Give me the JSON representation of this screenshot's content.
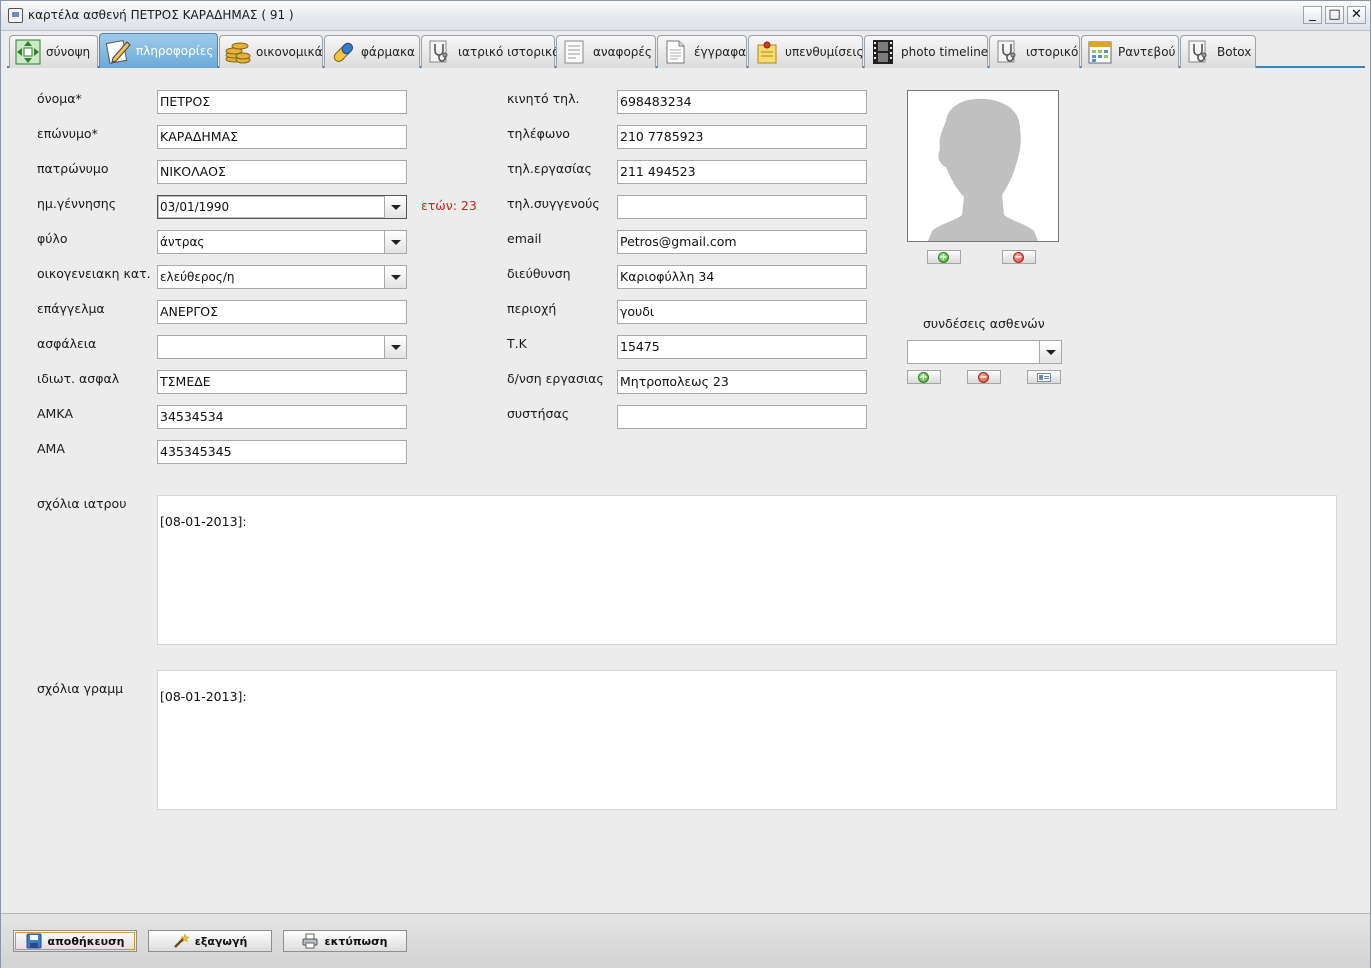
{
  "window": {
    "title": "καρτέλα ασθενή ΠΕΤΡΟΣ ΚΑΡΑΔΗΜΑΣ ( 91 )"
  },
  "window_controls": {
    "minimize": "_",
    "maximize": "□",
    "close": "✕"
  },
  "tabs": [
    {
      "label": "σύνοψη",
      "icon": "overview-arrows-icon",
      "active": false
    },
    {
      "label": "πληροφορίες",
      "icon": "edit-pencil-icon",
      "active": true
    },
    {
      "label": "οικονομικά",
      "icon": "coins-icon",
      "active": false
    },
    {
      "label": "φάρμακα",
      "icon": "pill-icon",
      "active": false
    },
    {
      "label": "ιατρικό ιστορικό",
      "icon": "stethoscope-icon",
      "active": false
    },
    {
      "label": "αναφορές",
      "icon": "report-sheet-icon",
      "active": false
    },
    {
      "label": "έγγραφα",
      "icon": "document-icon",
      "active": false
    },
    {
      "label": "υπενθυμίσεις",
      "icon": "sticky-note-icon",
      "active": false
    },
    {
      "label": "photo timeline",
      "icon": "film-strip-icon",
      "active": false
    },
    {
      "label": "ιστορικό",
      "icon": "stethoscope-icon",
      "active": false
    },
    {
      "label": "Ραντεβού",
      "icon": "calendar-icon",
      "active": false
    },
    {
      "label": "Botox",
      "icon": "stethoscope-icon",
      "active": false
    }
  ],
  "left_form": [
    {
      "label": "όνομα*",
      "value": "ΠΕΤΡΟΣ",
      "type": "text"
    },
    {
      "label": "επώνυμο*",
      "value": "ΚΑΡΑΔΗΜΑΣ",
      "type": "text"
    },
    {
      "label": "πατρώνυμο",
      "value": "ΝΙΚΟΛΑΟΣ",
      "type": "text"
    },
    {
      "label": "ημ.γέννησης",
      "value": "03/01/1990",
      "type": "combo"
    },
    {
      "label": "φύλο",
      "value": "άντρας",
      "type": "combo"
    },
    {
      "label": "οικογενειακη κατ.",
      "value": "ελεύθερος/η",
      "type": "combo"
    },
    {
      "label": "επάγγελμα",
      "value": "ΑΝΕΡΓΟΣ",
      "type": "text"
    },
    {
      "label": "ασφάλεια",
      "value": "",
      "type": "combo"
    },
    {
      "label": "ιδιωτ. ασφαλ",
      "value": "ΤΣΜΕΔΕ",
      "type": "text"
    },
    {
      "label": "ΑΜΚΑ",
      "value": "34534534",
      "type": "text"
    },
    {
      "label": "ΑΜΑ",
      "value": "435345345",
      "type": "text"
    }
  ],
  "age_text": "ετών: 23",
  "right_form": [
    {
      "label": "κινητό τηλ.",
      "value": "698483234"
    },
    {
      "label": "τηλέφωνο",
      "value": "210 7785923"
    },
    {
      "label": "τηλ.εργασίας",
      "value": "211 494523"
    },
    {
      "label": "τηλ.συγγενούς",
      "value": ""
    },
    {
      "label": "email",
      "value": "Petros@gmail.com"
    },
    {
      "label": "διεύθυνση",
      "value": "Καριοφύλλη 34"
    },
    {
      "label": "περιοχή",
      "value": "γουδι"
    },
    {
      "label": "Τ.Κ",
      "value": "15475"
    },
    {
      "label": "δ/νση εργασιας",
      "value": "Μητροπολεως 23"
    },
    {
      "label": "συστήσας",
      "value": ""
    }
  ],
  "photo_buttons": {
    "add": "+",
    "remove": "−"
  },
  "patient_links": {
    "title": "συνδέσεις ασθενών",
    "selected": "",
    "add": "+",
    "remove": "−"
  },
  "doctor_notes": {
    "label": "σχόλια ιατρου",
    "value": "[08-01-2013]:"
  },
  "secretary_notes": {
    "label": "σχόλια γραμμ",
    "value": "[08-01-2013]:"
  },
  "bottom_buttons": {
    "save": "αποθήκευση",
    "export": "εξαγωγή",
    "print": "εκτύπωση"
  },
  "colors": {
    "active_tab": "#6aaad8",
    "tab_underline": "#2f8bc2",
    "age_text": "#d11f1f",
    "window_bg": "#ececec"
  }
}
